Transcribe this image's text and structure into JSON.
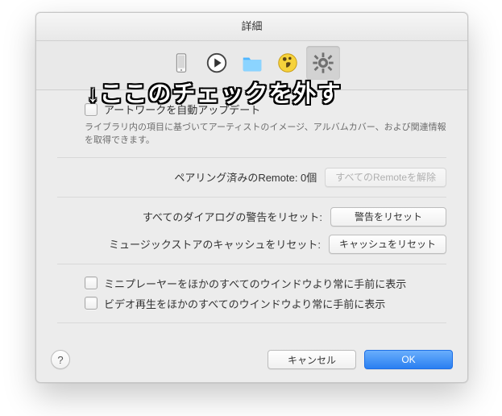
{
  "window": {
    "title": "詳細"
  },
  "toolbar": {
    "items": [
      {
        "name": "devices-tab",
        "selected": false
      },
      {
        "name": "playback-tab",
        "selected": false
      },
      {
        "name": "files-tab",
        "selected": false
      },
      {
        "name": "parental-tab",
        "selected": false
      },
      {
        "name": "advanced-tab",
        "selected": true
      }
    ]
  },
  "artwork": {
    "checkbox_checked": false,
    "label": "アートワークを自動アップデート",
    "desc": "ライブラリ内の項目に基づいてアーティストのイメージ、アルバムカバー、および関連情報を取得できます。"
  },
  "remote": {
    "label": "ペアリング済みのRemote: 0個",
    "button": "すべてのRemoteを解除",
    "button_enabled": false
  },
  "reset_dialogs": {
    "label": "すべてのダイアログの警告をリセット:",
    "button": "警告をリセット"
  },
  "reset_cache": {
    "label": "ミュージックストアのキャッシュをリセット:",
    "button": "キャッシュをリセット"
  },
  "miniplayer": {
    "checked": false,
    "label": "ミニプレーヤーをほかのすべてのウインドウより常に手前に表示"
  },
  "video": {
    "checked": false,
    "label": "ビデオ再生をほかのすべてのウインドウより常に手前に表示"
  },
  "footer": {
    "help": "?",
    "cancel": "キャンセル",
    "ok": "OK"
  },
  "annotation": {
    "text": "↓ここのチェックを外す"
  }
}
